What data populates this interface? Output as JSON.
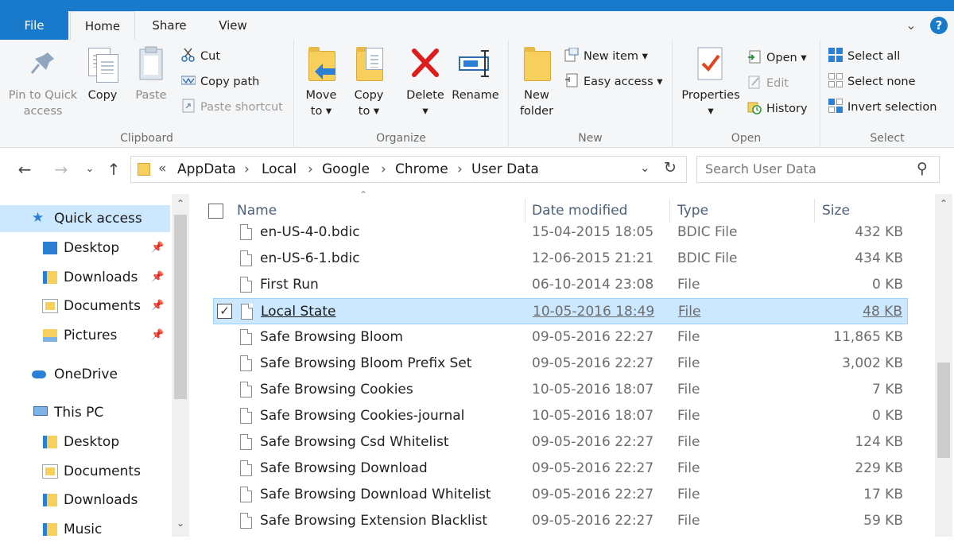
{
  "ribbon_tabs": {
    "file": "File",
    "home": "Home",
    "share": "Share",
    "view": "View"
  },
  "ribbon": {
    "clipboard": {
      "label": "Clipboard",
      "pin_line1": "Pin to Quick",
      "pin_line2": "access",
      "copy": "Copy",
      "paste": "Paste",
      "cut": "Cut",
      "copy_path": "Copy path",
      "paste_shortcut": "Paste shortcut"
    },
    "organize": {
      "label": "Organize",
      "move_line1": "Move",
      "move_line2": "to ▾",
      "copy_line1": "Copy",
      "copy_line2": "to ▾",
      "delete_line1": "Delete",
      "delete_line2": "▾",
      "rename": "Rename"
    },
    "new": {
      "label": "New",
      "folder_line1": "New",
      "folder_line2": "folder",
      "new_item": "New item ▾",
      "easy_access": "Easy access ▾"
    },
    "open": {
      "label": "Open",
      "properties_line1": "Properties",
      "properties_line2": "▾",
      "open": "Open ▾",
      "edit": "Edit",
      "history": "History"
    },
    "select": {
      "label": "Select",
      "select_all": "Select all",
      "select_none": "Select none",
      "invert": "Invert selection"
    }
  },
  "address": {
    "overflow": "«",
    "crumbs": [
      "AppData",
      "Local",
      "Google",
      "Chrome",
      "User Data"
    ],
    "sep": "›",
    "search_placeholder": "Search User Data"
  },
  "nav": {
    "quick_access": "Quick access",
    "qa_items": [
      "Desktop",
      "Downloads",
      "Documents",
      "Pictures"
    ],
    "onedrive": "OneDrive",
    "this_pc": "This PC",
    "pc_items": [
      "Desktop",
      "Documents",
      "Downloads",
      "Music"
    ]
  },
  "columns": {
    "name": "Name",
    "date": "Date modified",
    "type": "Type",
    "size": "Size"
  },
  "files": [
    {
      "name": "en-US-4-0.bdic",
      "date": "15-04-2015 18:05",
      "type": "BDIC File",
      "size": "432 KB"
    },
    {
      "name": "en-US-6-1.bdic",
      "date": "12-06-2015 21:21",
      "type": "BDIC File",
      "size": "434 KB"
    },
    {
      "name": "First Run",
      "date": "06-10-2014 23:08",
      "type": "File",
      "size": "0 KB"
    },
    {
      "name": "Local State",
      "date": "10-05-2016 18:49",
      "type": "File",
      "size": "48 KB",
      "selected": true
    },
    {
      "name": "Safe Browsing Bloom",
      "date": "09-05-2016 22:27",
      "type": "File",
      "size": "11,865 KB"
    },
    {
      "name": "Safe Browsing Bloom Prefix Set",
      "date": "09-05-2016 22:27",
      "type": "File",
      "size": "3,002 KB"
    },
    {
      "name": "Safe Browsing Cookies",
      "date": "10-05-2016 18:07",
      "type": "File",
      "size": "7 KB"
    },
    {
      "name": "Safe Browsing Cookies-journal",
      "date": "10-05-2016 18:07",
      "type": "File",
      "size": "0 KB"
    },
    {
      "name": "Safe Browsing Csd Whitelist",
      "date": "09-05-2016 22:27",
      "type": "File",
      "size": "124 KB"
    },
    {
      "name": "Safe Browsing Download",
      "date": "09-05-2016 22:27",
      "type": "File",
      "size": "229 KB"
    },
    {
      "name": "Safe Browsing Download Whitelist",
      "date": "09-05-2016 22:27",
      "type": "File",
      "size": "17 KB"
    },
    {
      "name": "Safe Browsing Extension Blacklist",
      "date": "09-05-2016 22:27",
      "type": "File",
      "size": "59 KB"
    }
  ],
  "colors": {
    "accent": "#1979ca",
    "selection": "#cce8ff",
    "selection_border": "#99d1ff",
    "folder": "#f7cf5d"
  }
}
